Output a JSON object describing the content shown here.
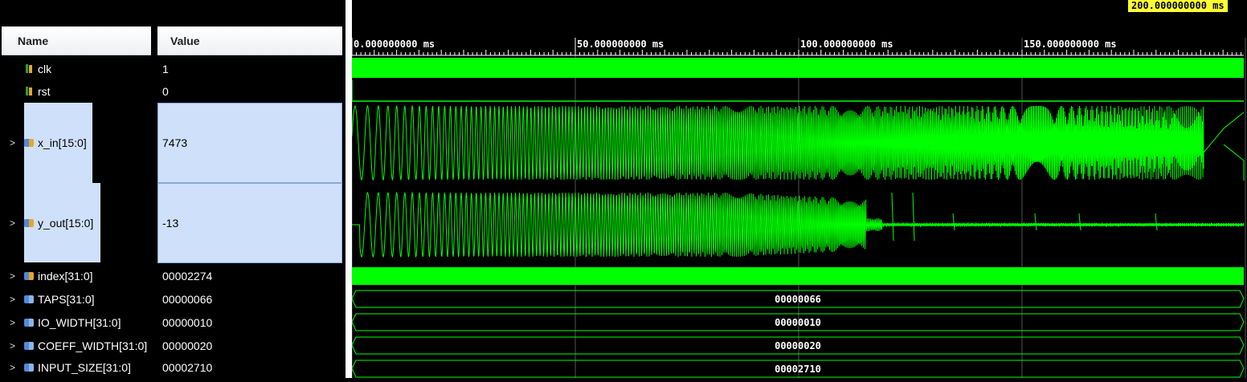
{
  "columns": {
    "name": "Name",
    "value": "Value"
  },
  "cursor": {
    "label": "200.000000000 ms"
  },
  "timeline": {
    "ticks": [
      "0.000000000 ms",
      "50.000000000 ms",
      "100.000000000 ms",
      "150.000000000 ms"
    ]
  },
  "signals": [
    {
      "name": "clk",
      "value": "1",
      "icon": "bit-signal-icon"
    },
    {
      "name": "rst",
      "value": "0",
      "icon": "bit-signal-icon"
    },
    {
      "name": "x_in[15:0]",
      "value": "7473",
      "icon": "bus-signal-icon"
    },
    {
      "name": "y_out[15:0]",
      "value": "-13",
      "icon": "bus-signal-icon"
    },
    {
      "name": "index[31:0]",
      "value": "00002274",
      "icon": "bus-signal-icon"
    },
    {
      "name": "TAPS[31:0]",
      "value": "00000066",
      "icon": "parameter-icon"
    },
    {
      "name": "IO_WIDTH[31:0]",
      "value": "00000010",
      "icon": "parameter-icon"
    },
    {
      "name": "COEFF_WIDTH[31:0]",
      "value": "00000020",
      "icon": "parameter-icon"
    },
    {
      "name": "INPUT_SIZE[31:0]",
      "value": "00002710",
      "icon": "parameter-icon"
    }
  ],
  "colors": {
    "wave": "#00ff00",
    "selection": "#cfe0fb",
    "cursor_bg": "#ffff33"
  }
}
